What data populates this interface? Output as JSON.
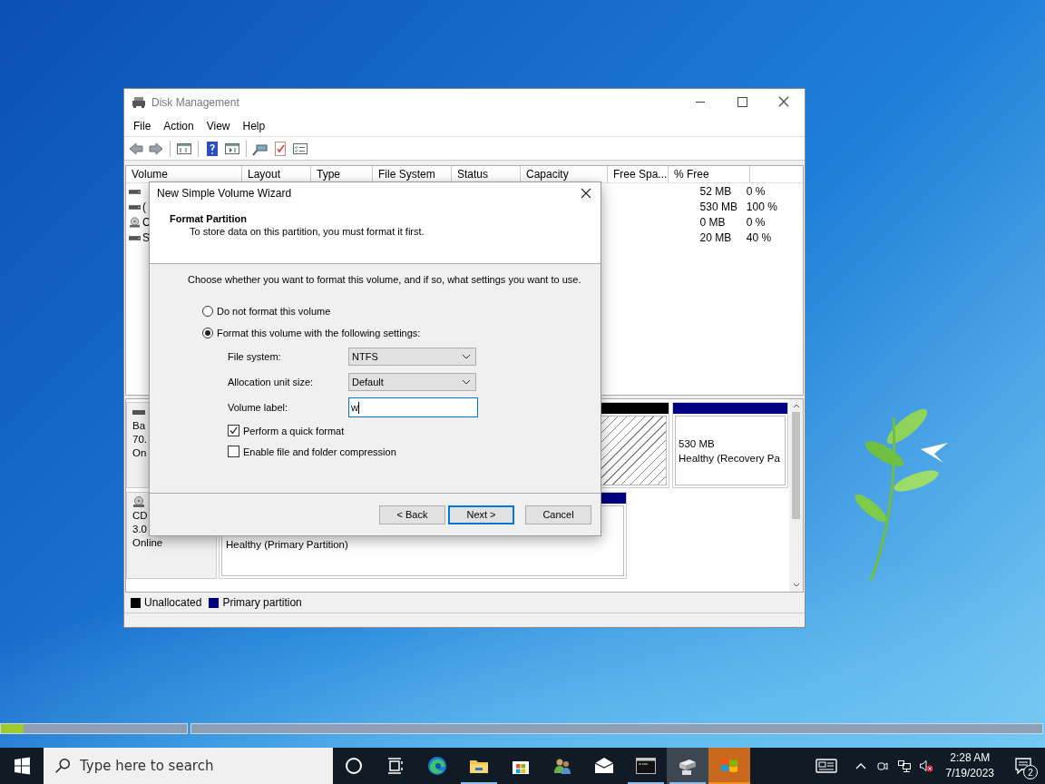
{
  "window": {
    "title": "Disk Management"
  },
  "menu": [
    "File",
    "Action",
    "View",
    "Help"
  ],
  "columns": [
    "Volume",
    "Layout",
    "Type",
    "File System",
    "Status",
    "Capacity",
    "Free Spa...",
    "% Free"
  ],
  "volumes": [
    {
      "kind": "disk",
      "free": "52 MB",
      "pct_free": "0 %"
    },
    {
      "kind": "disk",
      "volume": "(",
      "free": "530 MB",
      "pct_free": "100 %"
    },
    {
      "kind": "cd",
      "volume": "C",
      "free": "0 MB",
      "pct_free": "0 %"
    },
    {
      "kind": "disk",
      "volume": "S",
      "free": "20 MB",
      "pct_free": "40 %"
    }
  ],
  "disks": [
    {
      "kind": "disk",
      "lines": [
        "Ba",
        "70.",
        "On"
      ],
      "partitions": [
        {
          "kind": "unallocated"
        },
        {
          "kind": "primary",
          "lines": [
            "530 MB",
            "Healthy (Recovery Pa"
          ]
        }
      ]
    },
    {
      "kind": "cd",
      "lines": [
        "CD",
        "3.0",
        "Online"
      ],
      "partitions": [
        {
          "kind": "primary",
          "lines": [
            "Healthy (Primary Partition)"
          ]
        }
      ]
    }
  ],
  "legend": [
    {
      "label": "Unallocated",
      "color": "#000000"
    },
    {
      "label": "Primary partition",
      "color": "#000080"
    }
  ],
  "wizard": {
    "title": "New Simple Volume Wizard",
    "heading": "Format Partition",
    "subheading": "To store data on this partition, you must format it first.",
    "prompt": "Choose whether you want to format this volume, and if so, what settings you want to use.",
    "options": [
      {
        "label": "Do not format this volume",
        "selected": false
      },
      {
        "label": "Format this volume with the following settings:",
        "selected": true
      }
    ],
    "fields": [
      {
        "kind": "dropdown",
        "label": "File system:",
        "value": "NTFS"
      },
      {
        "kind": "dropdown",
        "label": "Allocation unit size:",
        "value": "Default"
      },
      {
        "kind": "text",
        "label": "Volume label:",
        "value": "w"
      }
    ],
    "checkboxes": [
      {
        "label": "Perform a quick format",
        "checked": true
      },
      {
        "label": "Enable file and folder compression",
        "checked": false
      }
    ],
    "buttons": [
      {
        "label": "< Back",
        "default": false
      },
      {
        "label": "Next >",
        "default": true
      },
      {
        "label": "Cancel",
        "default": false
      }
    ]
  },
  "desktop_bar": {
    "level": 0.12
  },
  "taskbar": {
    "search": {
      "placeholder": "Type here to search"
    },
    "apps": [
      {
        "kind": "cortana",
        "running": false,
        "selected": false,
        "flashing": false
      },
      {
        "kind": "task-view",
        "running": false,
        "selected": false,
        "flashing": false
      },
      {
        "kind": "edge",
        "running": false,
        "selected": false,
        "flashing": false
      },
      {
        "kind": "explorer",
        "running": true,
        "selected": false,
        "flashing": false
      },
      {
        "kind": "store",
        "running": false,
        "selected": false,
        "flashing": false
      },
      {
        "kind": "people",
        "running": false,
        "selected": false,
        "flashing": false
      },
      {
        "kind": "mail",
        "running": false,
        "selected": false,
        "flashing": false
      },
      {
        "kind": "terminal",
        "running": true,
        "selected": false,
        "flashing": false
      },
      {
        "kind": "disk-manager",
        "running": true,
        "selected": true,
        "flashing": false
      },
      {
        "kind": "windows-flag",
        "running": true,
        "selected": false,
        "flashing": true
      }
    ],
    "time": "2:28 AM",
    "date": "7/19/2023",
    "notifications": "2"
  }
}
